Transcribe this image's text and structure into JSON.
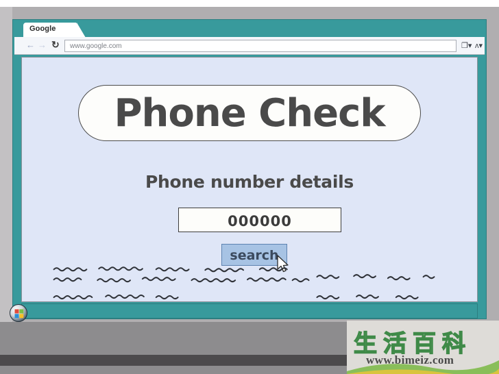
{
  "browser": {
    "tab_label": "Google",
    "address_value": "www.google.com",
    "nav": {
      "back": "←",
      "forward": "→",
      "reload": "↻"
    },
    "toolbar_icons": {
      "page": "❐▾",
      "wrench": "ᴧ▾"
    }
  },
  "page": {
    "hero_title": "Phone Check",
    "subtitle": "Phone number details",
    "phone_input_value": "000000",
    "phone_input_placeholder": "000000",
    "search_button_label": "search"
  },
  "taskbar": {
    "start_label": "Start"
  },
  "watermark": {
    "characters": "生活百科",
    "url": "www.bimeiz.com"
  },
  "colors": {
    "window_chrome": "#389a9c",
    "page_background": "#dfe6f7",
    "hero_text": "#4a4a4a",
    "button_fill": "#a7c3e4",
    "button_border": "#5d82b0",
    "bezel": "#b0aeb0",
    "watermark_green": "#3f8a48"
  }
}
